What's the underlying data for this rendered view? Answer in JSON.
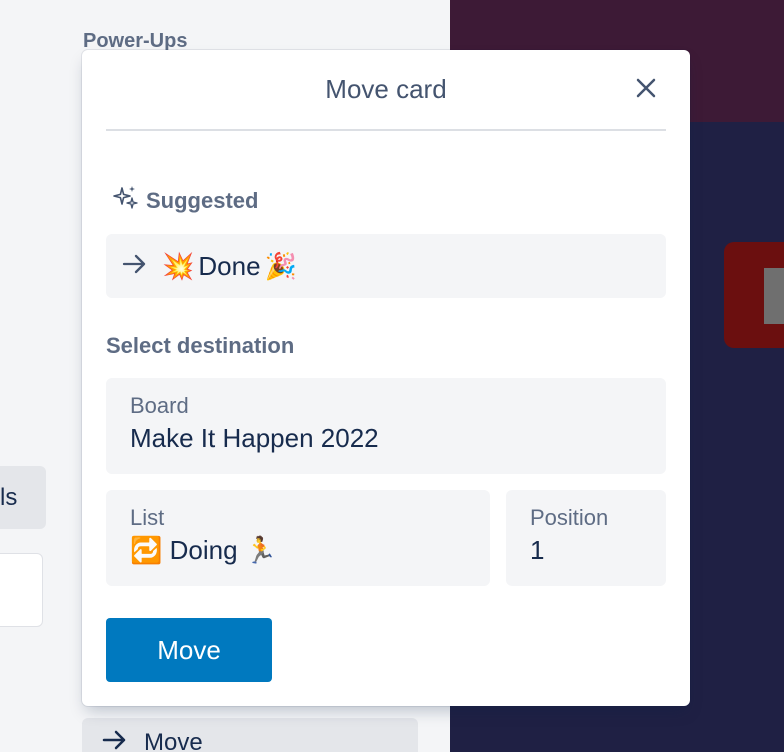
{
  "sidebar": {
    "heading": "Power-Ups",
    "partial_button_label": "ls",
    "move_button_label": "Move"
  },
  "dialog": {
    "title": "Move card",
    "close_icon": "close-icon",
    "suggested": {
      "heading": "Suggested",
      "heading_icon": "sparkles-icon",
      "item": {
        "arrow_icon": "arrow-right-icon",
        "prefix_emoji": "💥",
        "label": "Done",
        "suffix_emoji": "🎉"
      }
    },
    "select_destination": {
      "heading": "Select destination",
      "board": {
        "label": "Board",
        "value": "Make It Happen 2022"
      },
      "list": {
        "label": "List",
        "value": "🔁 Doing 🏃"
      },
      "position": {
        "label": "Position",
        "value": "1"
      }
    },
    "move_button": "Move"
  },
  "colors": {
    "primary_button": "#0079bf",
    "board_top": "#3d1a36",
    "board_bottom": "#1f2044",
    "text_muted": "#5e6c84",
    "text_main": "#172b4d"
  }
}
